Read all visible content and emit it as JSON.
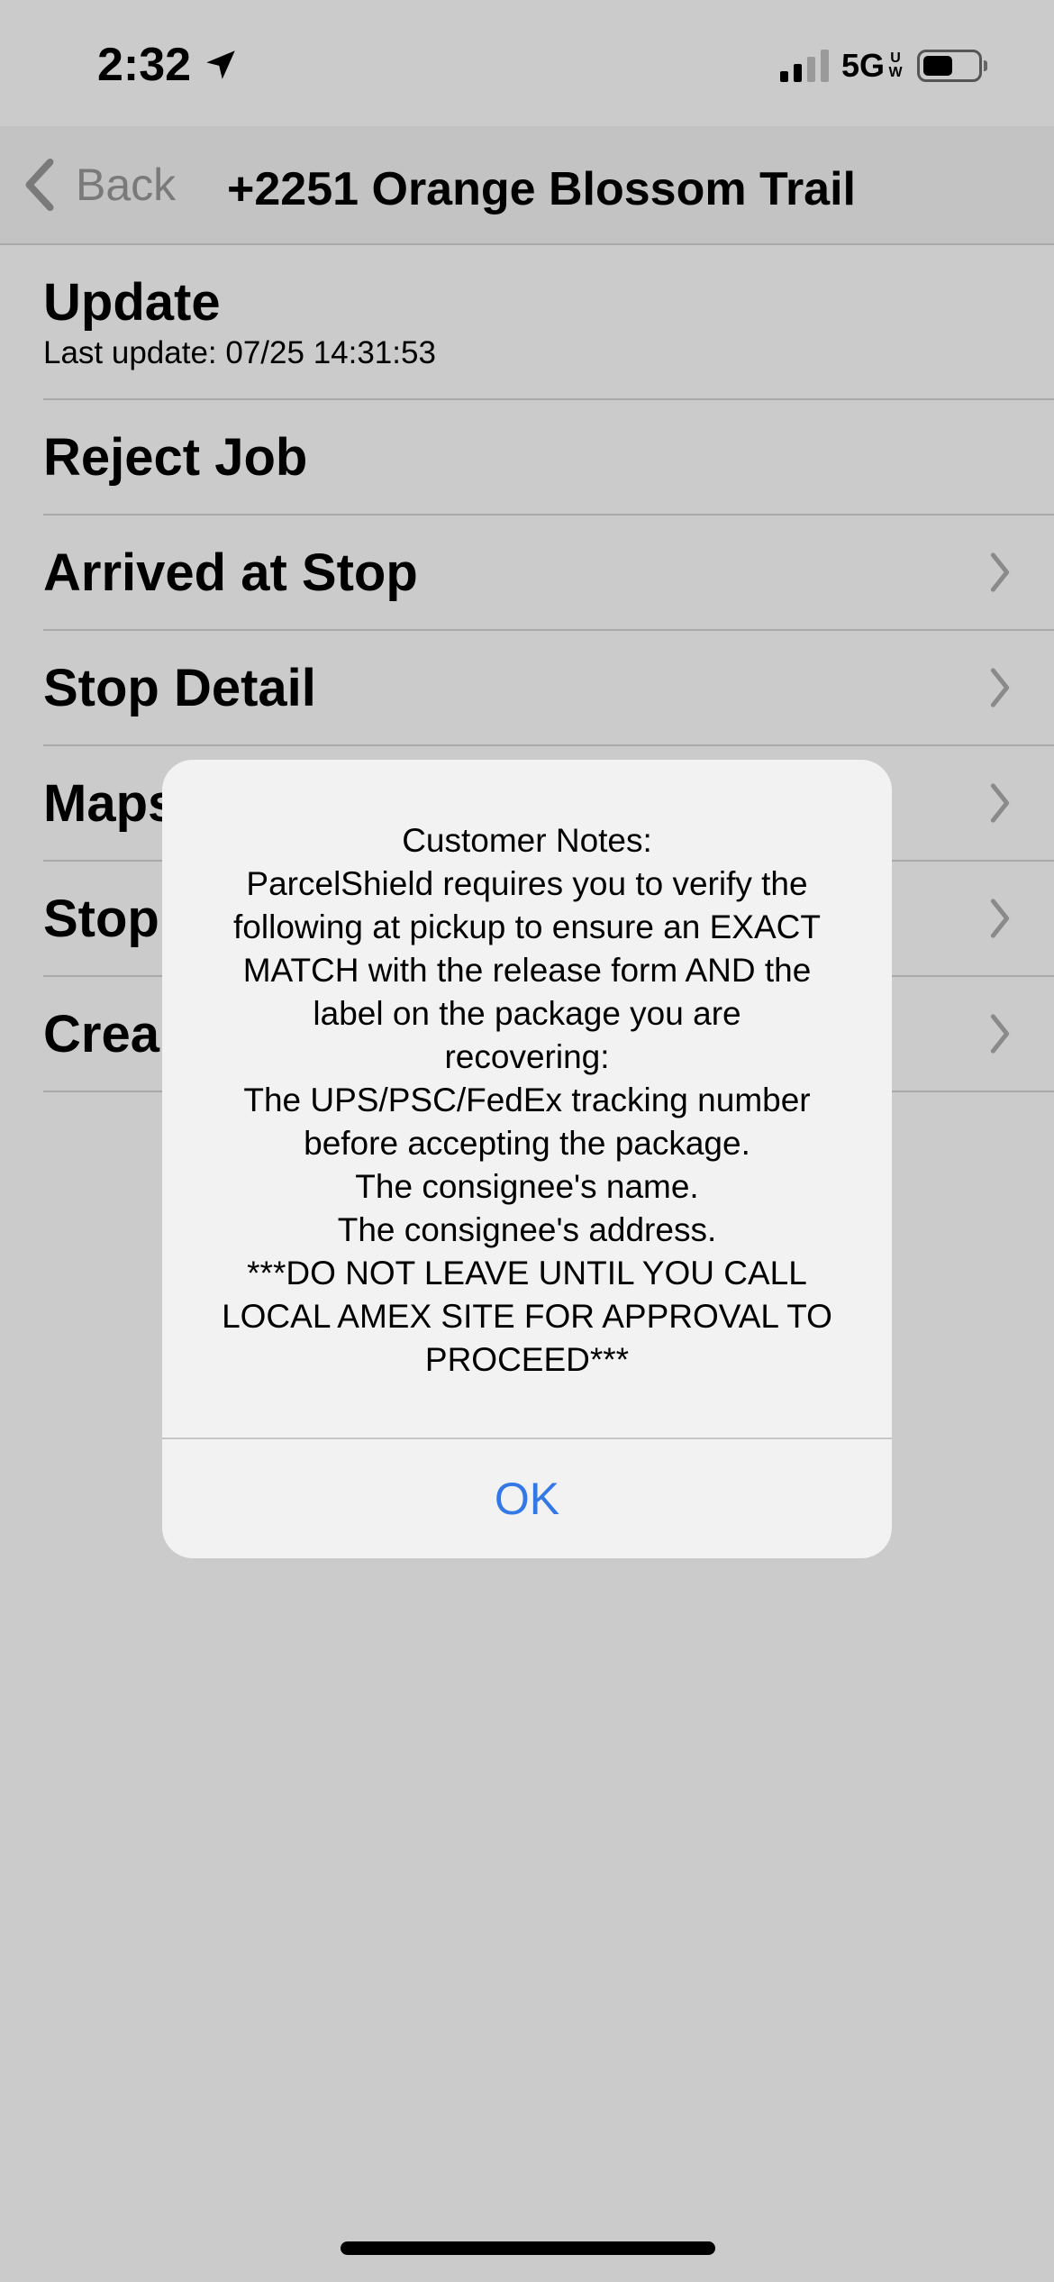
{
  "status_bar": {
    "time": "2:32",
    "network": "5G",
    "network_super_top": "U",
    "network_super_bottom": "W"
  },
  "nav": {
    "back_label": "Back",
    "title": "+2251 Orange Blossom Trail"
  },
  "list": {
    "update_title": "Update",
    "update_subtitle": "Last update: 07/25 14:31:53",
    "reject_job": "Reject Job",
    "arrived_at_stop": "Arrived at Stop",
    "stop_detail": "Stop Detail",
    "maps": "Maps",
    "stop": "Stop",
    "create": "Crea"
  },
  "dialog": {
    "lines": [
      "Customer Notes:",
      "ParcelShield requires you to verify the",
      "following at pickup to ensure an EXACT",
      "MATCH with the release form AND the",
      "label on the package you are",
      "recovering:",
      "The UPS/PSC/FedEx tracking number",
      "before accepting the package.",
      "The consignee's name.",
      "The consignee's address.",
      "***DO NOT LEAVE UNTIL YOU CALL",
      "LOCAL AMEX SITE FOR APPROVAL TO",
      "PROCEED***"
    ],
    "ok_label": "OK"
  },
  "colors": {
    "background": "#cbcbcb",
    "nav_background": "#c3c3c3",
    "dialog_background": "#f2f2f2",
    "accent_blue": "#3478e5",
    "back_gray": "#7a7a7a"
  },
  "icons": {
    "location": "location-arrow-icon",
    "back": "chevron-left-icon",
    "disclosure": "chevron-right-icon"
  }
}
